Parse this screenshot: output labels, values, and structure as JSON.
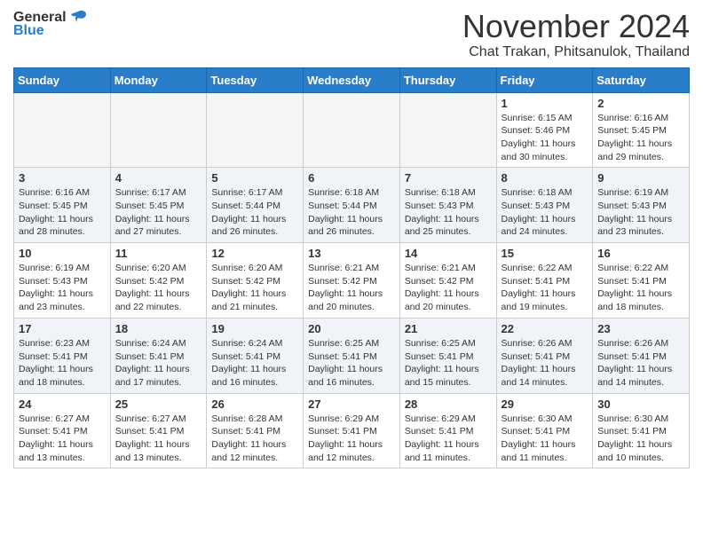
{
  "header": {
    "logo_general": "General",
    "logo_blue": "Blue",
    "month_year": "November 2024",
    "location": "Chat Trakan, Phitsanulok, Thailand"
  },
  "weekdays": [
    "Sunday",
    "Monday",
    "Tuesday",
    "Wednesday",
    "Thursday",
    "Friday",
    "Saturday"
  ],
  "weeks": [
    [
      {
        "day": "",
        "info": ""
      },
      {
        "day": "",
        "info": ""
      },
      {
        "day": "",
        "info": ""
      },
      {
        "day": "",
        "info": ""
      },
      {
        "day": "",
        "info": ""
      },
      {
        "day": "1",
        "info": "Sunrise: 6:15 AM\nSunset: 5:46 PM\nDaylight: 11 hours and 30 minutes."
      },
      {
        "day": "2",
        "info": "Sunrise: 6:16 AM\nSunset: 5:45 PM\nDaylight: 11 hours and 29 minutes."
      }
    ],
    [
      {
        "day": "3",
        "info": "Sunrise: 6:16 AM\nSunset: 5:45 PM\nDaylight: 11 hours and 28 minutes."
      },
      {
        "day": "4",
        "info": "Sunrise: 6:17 AM\nSunset: 5:45 PM\nDaylight: 11 hours and 27 minutes."
      },
      {
        "day": "5",
        "info": "Sunrise: 6:17 AM\nSunset: 5:44 PM\nDaylight: 11 hours and 26 minutes."
      },
      {
        "day": "6",
        "info": "Sunrise: 6:18 AM\nSunset: 5:44 PM\nDaylight: 11 hours and 26 minutes."
      },
      {
        "day": "7",
        "info": "Sunrise: 6:18 AM\nSunset: 5:43 PM\nDaylight: 11 hours and 25 minutes."
      },
      {
        "day": "8",
        "info": "Sunrise: 6:18 AM\nSunset: 5:43 PM\nDaylight: 11 hours and 24 minutes."
      },
      {
        "day": "9",
        "info": "Sunrise: 6:19 AM\nSunset: 5:43 PM\nDaylight: 11 hours and 23 minutes."
      }
    ],
    [
      {
        "day": "10",
        "info": "Sunrise: 6:19 AM\nSunset: 5:43 PM\nDaylight: 11 hours and 23 minutes."
      },
      {
        "day": "11",
        "info": "Sunrise: 6:20 AM\nSunset: 5:42 PM\nDaylight: 11 hours and 22 minutes."
      },
      {
        "day": "12",
        "info": "Sunrise: 6:20 AM\nSunset: 5:42 PM\nDaylight: 11 hours and 21 minutes."
      },
      {
        "day": "13",
        "info": "Sunrise: 6:21 AM\nSunset: 5:42 PM\nDaylight: 11 hours and 20 minutes."
      },
      {
        "day": "14",
        "info": "Sunrise: 6:21 AM\nSunset: 5:42 PM\nDaylight: 11 hours and 20 minutes."
      },
      {
        "day": "15",
        "info": "Sunrise: 6:22 AM\nSunset: 5:41 PM\nDaylight: 11 hours and 19 minutes."
      },
      {
        "day": "16",
        "info": "Sunrise: 6:22 AM\nSunset: 5:41 PM\nDaylight: 11 hours and 18 minutes."
      }
    ],
    [
      {
        "day": "17",
        "info": "Sunrise: 6:23 AM\nSunset: 5:41 PM\nDaylight: 11 hours and 18 minutes."
      },
      {
        "day": "18",
        "info": "Sunrise: 6:24 AM\nSunset: 5:41 PM\nDaylight: 11 hours and 17 minutes."
      },
      {
        "day": "19",
        "info": "Sunrise: 6:24 AM\nSunset: 5:41 PM\nDaylight: 11 hours and 16 minutes."
      },
      {
        "day": "20",
        "info": "Sunrise: 6:25 AM\nSunset: 5:41 PM\nDaylight: 11 hours and 16 minutes."
      },
      {
        "day": "21",
        "info": "Sunrise: 6:25 AM\nSunset: 5:41 PM\nDaylight: 11 hours and 15 minutes."
      },
      {
        "day": "22",
        "info": "Sunrise: 6:26 AM\nSunset: 5:41 PM\nDaylight: 11 hours and 14 minutes."
      },
      {
        "day": "23",
        "info": "Sunrise: 6:26 AM\nSunset: 5:41 PM\nDaylight: 11 hours and 14 minutes."
      }
    ],
    [
      {
        "day": "24",
        "info": "Sunrise: 6:27 AM\nSunset: 5:41 PM\nDaylight: 11 hours and 13 minutes."
      },
      {
        "day": "25",
        "info": "Sunrise: 6:27 AM\nSunset: 5:41 PM\nDaylight: 11 hours and 13 minutes."
      },
      {
        "day": "26",
        "info": "Sunrise: 6:28 AM\nSunset: 5:41 PM\nDaylight: 11 hours and 12 minutes."
      },
      {
        "day": "27",
        "info": "Sunrise: 6:29 AM\nSunset: 5:41 PM\nDaylight: 11 hours and 12 minutes."
      },
      {
        "day": "28",
        "info": "Sunrise: 6:29 AM\nSunset: 5:41 PM\nDaylight: 11 hours and 11 minutes."
      },
      {
        "day": "29",
        "info": "Sunrise: 6:30 AM\nSunset: 5:41 PM\nDaylight: 11 hours and 11 minutes."
      },
      {
        "day": "30",
        "info": "Sunrise: 6:30 AM\nSunset: 5:41 PM\nDaylight: 11 hours and 10 minutes."
      }
    ]
  ]
}
